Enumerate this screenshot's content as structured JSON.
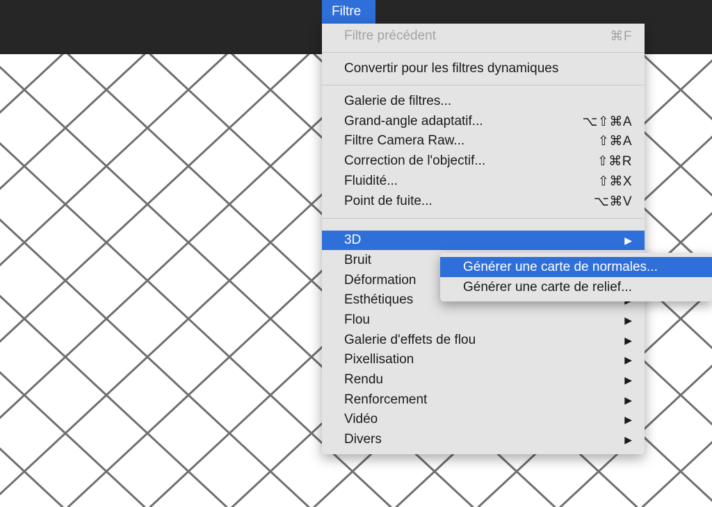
{
  "menu_bar": {
    "title": "Filtre"
  },
  "menu": {
    "items": [
      {
        "label": "Filtre précédent",
        "shortcut": "⌘F",
        "disabled": true
      },
      {
        "label": "Convertir pour les filtres dynamiques",
        "shortcut": ""
      },
      {
        "label": "Galerie de filtres...",
        "shortcut": ""
      },
      {
        "label": "Grand-angle adaptatif...",
        "shortcut": "⌥⇧⌘A"
      },
      {
        "label": "Filtre Camera Raw...",
        "shortcut": "⇧⌘A"
      },
      {
        "label": "Correction de l'objectif...",
        "shortcut": "⇧⌘R"
      },
      {
        "label": "Fluidité...",
        "shortcut": "⇧⌘X"
      },
      {
        "label": "Point de fuite...",
        "shortcut": "⌥⌘V"
      },
      {
        "label": "3D",
        "arrow": "▶",
        "highlighted": true
      },
      {
        "label": "Bruit",
        "arrow": "▶"
      },
      {
        "label": "Déformation",
        "arrow": "▶"
      },
      {
        "label": "Esthétiques",
        "arrow": "▶"
      },
      {
        "label": "Flou",
        "arrow": "▶"
      },
      {
        "label": "Galerie d'effets de flou",
        "arrow": "▶"
      },
      {
        "label": "Pixellisation",
        "arrow": "▶"
      },
      {
        "label": "Rendu",
        "arrow": "▶"
      },
      {
        "label": "Renforcement",
        "arrow": "▶"
      },
      {
        "label": "Vidéo",
        "arrow": "▶"
      },
      {
        "label": "Divers",
        "arrow": "▶"
      }
    ]
  },
  "submenu": {
    "items": [
      {
        "label": "Générer une carte de normales...",
        "highlighted": true
      },
      {
        "label": "Générer une carte de relief..."
      }
    ]
  },
  "colors": {
    "highlight": "#2e6fd9",
    "menu_bg": "#e4e4e4",
    "topbar": "#262626",
    "fence_wire": "#6f6f6f"
  }
}
